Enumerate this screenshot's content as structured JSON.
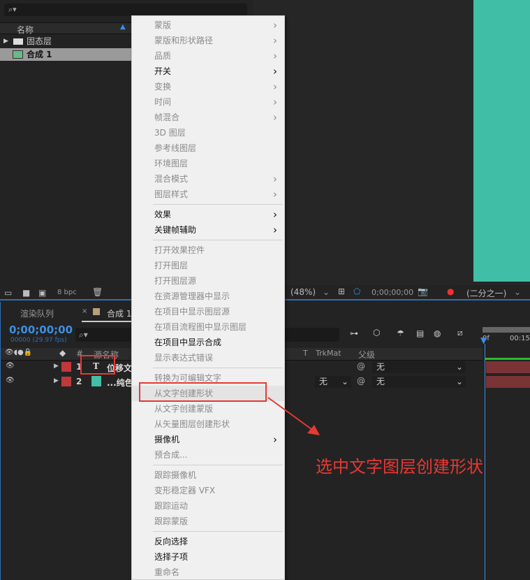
{
  "project": {
    "search_placeholder": "⌕▾",
    "column_name": "名称",
    "items": [
      {
        "name": "固态层",
        "type": "folder"
      },
      {
        "name": "合成 1",
        "type": "composition",
        "selected": true
      }
    ]
  },
  "viewer": {
    "zoom": "(48%)",
    "timecode": "0;00;00;00",
    "resolution": "(二分之一)",
    "bpc": "8 bpc",
    "background_color": "#41bfa6"
  },
  "timeline": {
    "tabs": [
      {
        "label": "渲染队列"
      },
      {
        "label": "合成 1",
        "active": true
      }
    ],
    "timecode": "0;00;00;00",
    "fps": "00000 (29.97 fps)",
    "col_source": "源名称",
    "col_num": "#",
    "col_t": "T",
    "col_trkmat": "TrkMat",
    "col_parent": "父级",
    "ruler": [
      "0f",
      "00:15f"
    ],
    "layers": [
      {
        "num": "1",
        "name": "位移文",
        "type": "text",
        "label_color": "#c0383a",
        "trkmat": "",
        "parent": "无"
      },
      {
        "num": "2",
        "name": "...纯色",
        "type": "solid",
        "label_color": "#c0383a",
        "trkmat": "无",
        "parent": "无"
      }
    ]
  },
  "menu": {
    "items": [
      {
        "label": "蒙版",
        "enabled": false,
        "submenu": true
      },
      {
        "label": "蒙版和形状路径",
        "enabled": false,
        "submenu": true
      },
      {
        "label": "品质",
        "enabled": false,
        "submenu": true
      },
      {
        "label": "开关",
        "enabled": true,
        "submenu": true
      },
      {
        "label": "变换",
        "enabled": false,
        "submenu": true
      },
      {
        "label": "时间",
        "enabled": false,
        "submenu": true
      },
      {
        "label": "帧混合",
        "enabled": false,
        "submenu": true
      },
      {
        "label": "3D 图层",
        "enabled": false
      },
      {
        "label": "参考线图层",
        "enabled": false
      },
      {
        "label": "环境图层",
        "enabled": false
      },
      {
        "label": "混合模式",
        "enabled": false,
        "submenu": true
      },
      {
        "label": "图层样式",
        "enabled": false,
        "submenu": true
      },
      {
        "label": "效果",
        "enabled": true,
        "submenu": true
      },
      {
        "label": "关键帧辅助",
        "enabled": true,
        "submenu": true
      },
      {
        "label": "打开效果控件",
        "enabled": false
      },
      {
        "label": "打开图层",
        "enabled": false
      },
      {
        "label": "打开图层源",
        "enabled": false
      },
      {
        "label": "在资源管理器中显示",
        "enabled": false
      },
      {
        "label": "在项目中显示图层源",
        "enabled": false
      },
      {
        "label": "在项目流程图中显示图层",
        "enabled": false
      },
      {
        "label": "在项目中显示合成",
        "enabled": true
      },
      {
        "label": "显示表达式错误",
        "enabled": false
      },
      {
        "label": "转换为可编辑文字",
        "enabled": false
      },
      {
        "label": "从文字创建形状",
        "enabled": false,
        "highlighted": true
      },
      {
        "label": "从文字创建蒙版",
        "enabled": false
      },
      {
        "label": "从矢量图层创建形状",
        "enabled": false
      },
      {
        "label": "摄像机",
        "enabled": true,
        "submenu": true
      },
      {
        "label": "预合成...",
        "enabled": false
      },
      {
        "label": "跟踪摄像机",
        "enabled": false
      },
      {
        "label": "变形稳定器 VFX",
        "enabled": false
      },
      {
        "label": "跟踪运动",
        "enabled": false
      },
      {
        "label": "跟踪蒙版",
        "enabled": false
      },
      {
        "label": "反向选择",
        "enabled": true
      },
      {
        "label": "选择子项",
        "enabled": true
      },
      {
        "label": "重命名",
        "enabled": false
      }
    ]
  },
  "annotation": "选中文字图层创建形状",
  "colors": {
    "annotation": "#e53935",
    "accent": "#3d8fe0"
  }
}
